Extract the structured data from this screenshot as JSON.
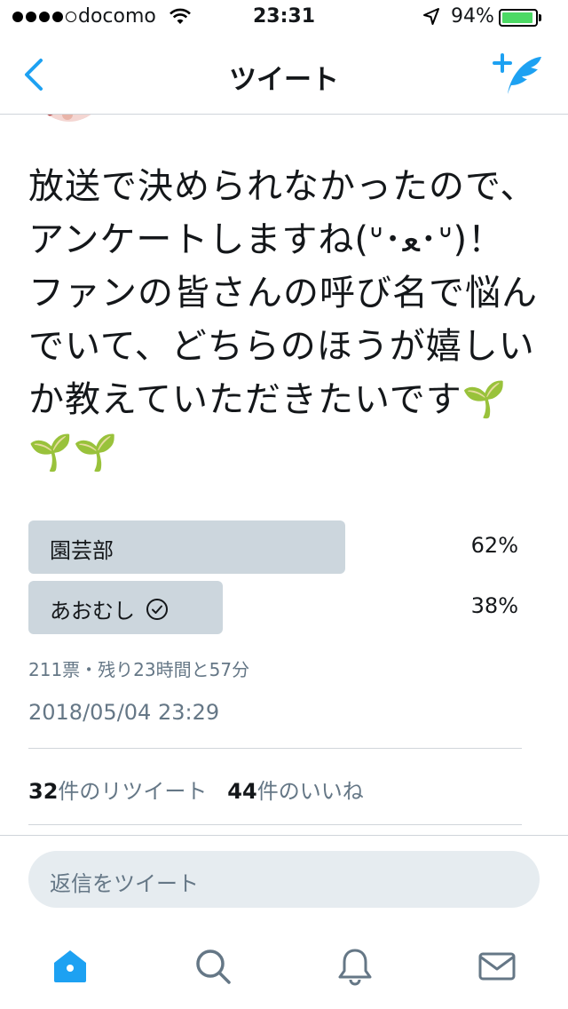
{
  "status_bar": {
    "carrier": "docomo",
    "time": "23:31",
    "battery_percent": "94%",
    "battery_level": 0.94,
    "signal_bars": 4,
    "signal_total": 5
  },
  "nav": {
    "title": "ツイート",
    "back_icon": "chevron-left-icon",
    "compose_icon": "compose-tweet-icon"
  },
  "tweet": {
    "text": "放送で決められなかったので、\nアンケートしますね(ᐡ･ﻌ･ᐡ)！\nファンの皆さんの呼び名で悩ん\nでいて、どちらのほうが嬉しい\nか教えていただきたいです🌱\n🌱🌱"
  },
  "poll": {
    "options": [
      {
        "label": "園芸部",
        "percent": "62%",
        "fraction": 0.62,
        "selected": false
      },
      {
        "label": "あおむし",
        "percent": "38%",
        "fraction": 0.38,
        "selected": true
      }
    ],
    "meta": "211票・残り23時間と57分"
  },
  "timestamp": "2018/05/04 23:29",
  "stats": {
    "retweets_count": "32",
    "retweets_label": "件のリツイート",
    "likes_count": "44",
    "likes_label": "件のいいね"
  },
  "reply": {
    "placeholder": "返信をツイート"
  },
  "tabbar": {
    "items": [
      "home-icon",
      "search-icon",
      "notifications-icon",
      "messages-icon"
    ],
    "active": "home-icon"
  },
  "colors": {
    "accent": "#1da1f2",
    "poll_bar": "#ccd6dd",
    "secondary_text": "#657786",
    "battery": "#4cd964",
    "icon_gray": "#657786"
  }
}
